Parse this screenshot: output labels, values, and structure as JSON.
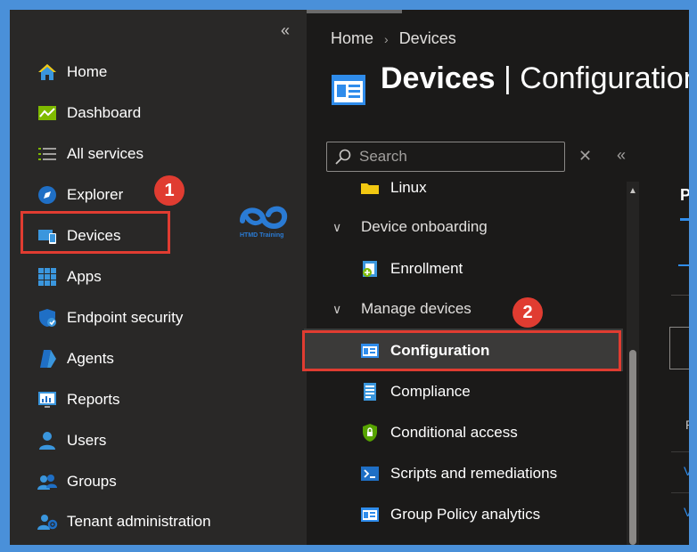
{
  "leftnav": {
    "collapse_glyph": "«",
    "items": [
      {
        "label": "Home",
        "icon": "home-icon"
      },
      {
        "label": "Dashboard",
        "icon": "dashboard-icon"
      },
      {
        "label": "All services",
        "icon": "all-services-icon"
      },
      {
        "label": "Explorer",
        "icon": "explorer-icon"
      },
      {
        "label": "Devices",
        "icon": "devices-icon"
      },
      {
        "label": "Apps",
        "icon": "apps-icon"
      },
      {
        "label": "Endpoint security",
        "icon": "endpoint-security-icon"
      },
      {
        "label": "Agents",
        "icon": "agents-icon"
      },
      {
        "label": "Reports",
        "icon": "reports-icon"
      },
      {
        "label": "Users",
        "icon": "users-icon"
      },
      {
        "label": "Groups",
        "icon": "groups-icon"
      },
      {
        "label": "Tenant administration",
        "icon": "tenant-admin-icon"
      }
    ]
  },
  "annotations": {
    "badge1": "1",
    "badge2": "2",
    "logo_text": "HTMD Training"
  },
  "breadcrumb": {
    "home": "Home",
    "sep": "›",
    "current": "Devices"
  },
  "header": {
    "title_bold": "Devices",
    "title_rest": " | Configuration"
  },
  "search": {
    "placeholder": "Search",
    "clear_glyph": "✕",
    "collapse_glyph": "«"
  },
  "menu": {
    "linux": "Linux",
    "group_onboarding": "Device onboarding",
    "enrollment": "Enrollment",
    "group_manage": "Manage devices",
    "configuration": "Configuration",
    "compliance": "Compliance",
    "conditional_access": "Conditional access",
    "scripts": "Scripts and remediations",
    "gpa": "Group Policy analytics",
    "chevron": "∨"
  },
  "right": {
    "tab": "P",
    "p": "P",
    "w": "V"
  },
  "colors": {
    "accent": "#2f8ceb",
    "highlight": "#e03c31",
    "frame": "#4a90d9"
  }
}
